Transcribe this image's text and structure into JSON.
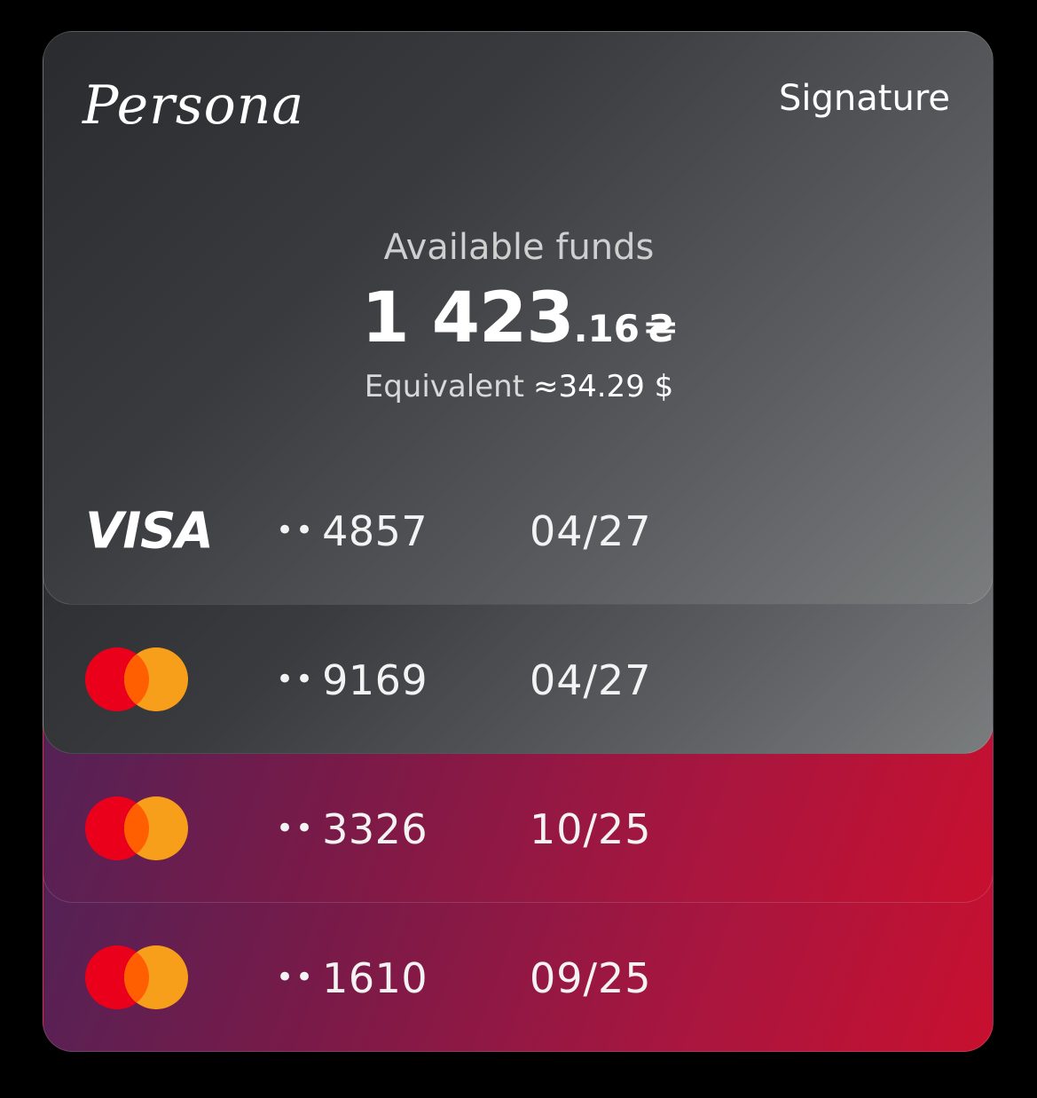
{
  "card": {
    "brand": "Persona",
    "tier": "Signature",
    "funds_label": "Available funds",
    "amount_major": "1 423",
    "amount_minor": ".16",
    "currency": "₴",
    "equivalent_label": "Equivalent",
    "equivalent_value": "≈34.29 $"
  },
  "cards": [
    {
      "network": "VISA",
      "dots": "••",
      "last4": "4857",
      "expiry": "04/27"
    },
    {
      "network": "mastercard-icon",
      "dots": "••",
      "last4": "9169",
      "expiry": "04/27"
    },
    {
      "network": "mastercard-icon",
      "dots": "••",
      "last4": "3326",
      "expiry": "10/25"
    },
    {
      "network": "mastercard-icon",
      "dots": "••",
      "last4": "1610",
      "expiry": "09/25"
    }
  ],
  "colors": {
    "grey_gradient_start": "#2a2b2e",
    "grey_gradient_end": "#7a7d7d",
    "red_gradient_start": "#4e2358",
    "red_gradient_end": "#c8102f",
    "mastercard_red": "#eb001b",
    "mastercard_orange": "#f79e1b"
  }
}
